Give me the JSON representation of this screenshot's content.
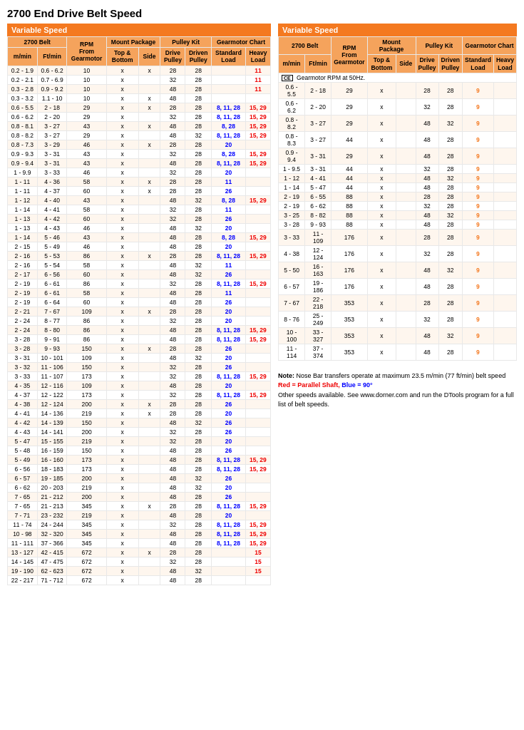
{
  "page": {
    "title": "2700 End Drive Belt Speed"
  },
  "left_table": {
    "section_label": "Variable Speed",
    "col_headers": {
      "belt": "2700 Belt",
      "rpm": "RPM From Gearmotor",
      "mount": "Mount Package",
      "pulley_kit": "Pulley Kit",
      "gearmotor": "Gearmotor Chart"
    },
    "sub_headers": [
      "m/min",
      "Ft/min",
      "",
      "Top & Bottom",
      "Side",
      "Drive Pulley",
      "Driven Pulley",
      "Standard Load",
      "Heavy Load"
    ],
    "rows": [
      [
        "0.2 - 1.9",
        "0.6 - 6.2",
        "10",
        "x",
        "x",
        "28",
        "28",
        "",
        "11"
      ],
      [
        "0.2 - 2.1",
        "0.7 - 6.9",
        "10",
        "x",
        "",
        "32",
        "28",
        "",
        "11"
      ],
      [
        "0.3 - 2.8",
        "0.9 - 9.2",
        "10",
        "x",
        "",
        "48",
        "28",
        "",
        "11"
      ],
      [
        "0.3 - 3.2",
        "1.1 - 10",
        "10",
        "x",
        "x",
        "48",
        "28",
        "",
        ""
      ],
      [
        "0.6 - 5.5",
        "2 - 18",
        "29",
        "x",
        "x",
        "28",
        "28",
        "8, 11, 28",
        "15, 29"
      ],
      [
        "0.6 - 6.2",
        "2 - 20",
        "29",
        "x",
        "",
        "32",
        "28",
        "8, 11, 28",
        "15, 29"
      ],
      [
        "0.8 - 8.1",
        "3 - 27",
        "43",
        "x",
        "x",
        "48",
        "28",
        "8, 28",
        "15, 29"
      ],
      [
        "0.8 - 8.2",
        "3 - 27",
        "29",
        "x",
        "",
        "48",
        "32",
        "8, 11, 28",
        "15, 29"
      ],
      [
        "0.8 - 7.3",
        "3 - 29",
        "46",
        "x",
        "x",
        "28",
        "28",
        "20",
        ""
      ],
      [
        "0.9 - 9.3",
        "3 - 31",
        "43",
        "x",
        "",
        "32",
        "28",
        "8, 28",
        "15, 29"
      ],
      [
        "0.9 - 9.4",
        "3 - 31",
        "43",
        "x",
        "",
        "48",
        "28",
        "8, 11, 28",
        "15, 29"
      ],
      [
        "1 - 9.9",
        "3 - 33",
        "46",
        "x",
        "",
        "32",
        "28",
        "20",
        ""
      ],
      [
        "1 - 11",
        "4 - 36",
        "58",
        "x",
        "x",
        "28",
        "28",
        "11",
        ""
      ],
      [
        "1 - 11",
        "4 - 37",
        "60",
        "x",
        "x",
        "28",
        "28",
        "26",
        ""
      ],
      [
        "1 - 12",
        "4 - 40",
        "43",
        "x",
        "",
        "48",
        "32",
        "8, 28",
        "15, 29"
      ],
      [
        "1 - 14",
        "4 - 41",
        "58",
        "x",
        "",
        "32",
        "28",
        "11",
        ""
      ],
      [
        "1 - 13",
        "4 - 42",
        "60",
        "x",
        "",
        "32",
        "28",
        "26",
        ""
      ],
      [
        "1 - 13",
        "4 - 43",
        "46",
        "x",
        "",
        "48",
        "32",
        "20",
        ""
      ],
      [
        "1 - 14",
        "5 - 46",
        "43",
        "x",
        "",
        "48",
        "28",
        "8, 28",
        "15, 29"
      ],
      [
        "2 - 15",
        "5 - 49",
        "46",
        "x",
        "",
        "48",
        "28",
        "20",
        ""
      ],
      [
        "2 - 16",
        "5 - 53",
        "86",
        "x",
        "x",
        "28",
        "28",
        "8, 11, 28",
        "15, 29"
      ],
      [
        "2 - 16",
        "5 - 54",
        "58",
        "x",
        "",
        "48",
        "32",
        "11",
        ""
      ],
      [
        "2 - 17",
        "6 - 56",
        "60",
        "x",
        "",
        "48",
        "32",
        "26",
        ""
      ],
      [
        "2 - 19",
        "6 - 61",
        "86",
        "x",
        "",
        "32",
        "28",
        "8, 11, 28",
        "15, 29"
      ],
      [
        "2 - 19",
        "6 - 61",
        "58",
        "x",
        "",
        "48",
        "28",
        "11",
        ""
      ],
      [
        "2 - 19",
        "6 - 64",
        "60",
        "x",
        "",
        "48",
        "28",
        "26",
        ""
      ],
      [
        "2 - 21",
        "7 - 67",
        "109",
        "x",
        "x",
        "28",
        "28",
        "20",
        ""
      ],
      [
        "2 - 24",
        "8 - 77",
        "86",
        "x",
        "",
        "32",
        "28",
        "20",
        ""
      ],
      [
        "2 - 24",
        "8 - 80",
        "86",
        "x",
        "",
        "48",
        "28",
        "8, 11, 28",
        "15, 29"
      ],
      [
        "3 - 28",
        "9 - 91",
        "86",
        "x",
        "",
        "48",
        "28",
        "8, 11, 28",
        "15, 29"
      ],
      [
        "3 - 28",
        "9 - 93",
        "150",
        "x",
        "x",
        "28",
        "28",
        "26",
        ""
      ],
      [
        "3 - 31",
        "10 - 101",
        "109",
        "x",
        "",
        "48",
        "32",
        "20",
        ""
      ],
      [
        "3 - 32",
        "11 - 106",
        "150",
        "x",
        "",
        "32",
        "28",
        "26",
        ""
      ],
      [
        "3 - 33",
        "11 - 107",
        "173",
        "x",
        "",
        "32",
        "28",
        "8, 11, 28",
        "15, 29"
      ],
      [
        "4 - 35",
        "12 - 116",
        "109",
        "x",
        "",
        "48",
        "28",
        "20",
        ""
      ],
      [
        "4 - 37",
        "12 - 122",
        "173",
        "x",
        "",
        "32",
        "28",
        "8, 11, 28",
        "15, 29"
      ],
      [
        "4 - 38",
        "12 - 124",
        "200",
        "x",
        "x",
        "28",
        "28",
        "26",
        ""
      ],
      [
        "4 - 41",
        "14 - 136",
        "219",
        "x",
        "x",
        "28",
        "28",
        "20",
        ""
      ],
      [
        "4 - 42",
        "14 - 139",
        "150",
        "x",
        "",
        "48",
        "32",
        "26",
        ""
      ],
      [
        "4 - 43",
        "14 - 141",
        "200",
        "x",
        "",
        "32",
        "28",
        "26",
        ""
      ],
      [
        "5 - 47",
        "15 - 155",
        "219",
        "x",
        "",
        "32",
        "28",
        "20",
        ""
      ],
      [
        "5 - 48",
        "16 - 159",
        "150",
        "x",
        "",
        "48",
        "28",
        "26",
        ""
      ],
      [
        "5 - 49",
        "16 - 160",
        "173",
        "x",
        "",
        "48",
        "28",
        "8, 11, 28",
        "15, 29"
      ],
      [
        "6 - 56",
        "18 - 183",
        "173",
        "x",
        "",
        "48",
        "28",
        "8, 11, 28",
        "15, 29"
      ],
      [
        "6 - 57",
        "19 - 185",
        "200",
        "x",
        "",
        "48",
        "32",
        "26",
        ""
      ],
      [
        "6 - 62",
        "20 - 203",
        "219",
        "x",
        "",
        "48",
        "32",
        "20",
        ""
      ],
      [
        "7 - 65",
        "21 - 212",
        "200",
        "x",
        "",
        "48",
        "28",
        "26",
        ""
      ],
      [
        "7 - 65",
        "21 - 213",
        "345",
        "x",
        "x",
        "28",
        "28",
        "8, 11, 28",
        "15, 29"
      ],
      [
        "7 - 71",
        "23 - 232",
        "219",
        "x",
        "",
        "48",
        "28",
        "20",
        ""
      ],
      [
        "11 - 74",
        "24 - 244",
        "345",
        "x",
        "",
        "32",
        "28",
        "8, 11, 28",
        "15, 29"
      ],
      [
        "10 - 98",
        "32 - 320",
        "345",
        "x",
        "",
        "48",
        "28",
        "8, 11, 28",
        "15, 29"
      ],
      [
        "11 - 111",
        "37 - 366",
        "345",
        "x",
        "",
        "48",
        "28",
        "8, 11, 28",
        "15, 29"
      ],
      [
        "13 - 127",
        "42 - 415",
        "672",
        "x",
        "x",
        "28",
        "28",
        "",
        "15"
      ],
      [
        "14 - 145",
        "47 - 475",
        "672",
        "x",
        "",
        "32",
        "28",
        "",
        "15"
      ],
      [
        "19 - 190",
        "62 - 623",
        "672",
        "x",
        "",
        "48",
        "32",
        "",
        "15"
      ],
      [
        "22 - 217",
        "71 - 712",
        "672",
        "x",
        "",
        "48",
        "28",
        "",
        ""
      ]
    ]
  },
  "right_table": {
    "section_label": "Variable Speed",
    "ce_note": "Gearmotor RPM at 50Hz.",
    "col_headers": {
      "belt": "2700 Belt",
      "rpm": "RPM From Gearmotor",
      "mount": "Mount Package",
      "pulley_kit": "Pulley Kit",
      "gearmotor": "Gearmotor Chart"
    },
    "sub_headers": [
      "m/min",
      "Ft/min",
      "",
      "Top & Bottom",
      "Side",
      "Drive Pulley",
      "Driven Pulley",
      "Standard Load",
      "Heavy Load"
    ],
    "rows": [
      [
        "0.6 - 5.5",
        "2 - 18",
        "29",
        "x",
        "",
        "28",
        "28",
        "9",
        ""
      ],
      [
        "0.6 - 6.2",
        "2 - 20",
        "29",
        "x",
        "",
        "32",
        "28",
        "9",
        ""
      ],
      [
        "0.8 - 8.2",
        "3 - 27",
        "29",
        "x",
        "",
        "48",
        "32",
        "9",
        ""
      ],
      [
        "0.8 - 8.3",
        "3 - 27",
        "44",
        "x",
        "",
        "48",
        "28",
        "9",
        ""
      ],
      [
        "0.9 - 9.4",
        "3 - 31",
        "29",
        "x",
        "",
        "48",
        "28",
        "9",
        ""
      ],
      [
        "1 - 9.5",
        "3 - 31",
        "44",
        "x",
        "",
        "32",
        "28",
        "9",
        ""
      ],
      [
        "1 - 12",
        "4 - 41",
        "44",
        "x",
        "",
        "48",
        "32",
        "9",
        ""
      ],
      [
        "1 - 14",
        "5 - 47",
        "44",
        "x",
        "",
        "48",
        "28",
        "9",
        ""
      ],
      [
        "2 - 19",
        "6 - 55",
        "88",
        "x",
        "",
        "28",
        "28",
        "9",
        ""
      ],
      [
        "2 - 19",
        "6 - 62",
        "88",
        "x",
        "",
        "32",
        "28",
        "9",
        ""
      ],
      [
        "3 - 25",
        "8 - 82",
        "88",
        "x",
        "",
        "48",
        "32",
        "9",
        ""
      ],
      [
        "3 - 28",
        "9 - 93",
        "88",
        "x",
        "",
        "48",
        "28",
        "9",
        ""
      ],
      [
        "3 - 33",
        "11 - 109",
        "176",
        "x",
        "",
        "28",
        "28",
        "9",
        ""
      ],
      [
        "4 - 38",
        "12 - 124",
        "176",
        "x",
        "",
        "32",
        "28",
        "9",
        ""
      ],
      [
        "5 - 50",
        "16 - 163",
        "176",
        "x",
        "",
        "48",
        "32",
        "9",
        ""
      ],
      [
        "6 - 57",
        "19 - 186",
        "176",
        "x",
        "",
        "48",
        "28",
        "9",
        ""
      ],
      [
        "7 - 67",
        "22 - 218",
        "353",
        "x",
        "",
        "28",
        "28",
        "9",
        ""
      ],
      [
        "8 - 76",
        "25 - 249",
        "353",
        "x",
        "",
        "32",
        "28",
        "9",
        ""
      ],
      [
        "10 - 100",
        "33 - 327",
        "353",
        "x",
        "",
        "48",
        "32",
        "9",
        ""
      ],
      [
        "11 - 114",
        "37 - 374",
        "353",
        "x",
        "",
        "48",
        "28",
        "9",
        ""
      ]
    ]
  },
  "notes": {
    "note_label": "Note:",
    "note_text": "Nose Bar transfers operate at maximum 23.5 m/min (77 ft/min) belt speed",
    "legend_red": "Red = Parallel Shaft,",
    "legend_blue": "Blue = 90°",
    "other_speeds": "Other speeds available. See www.dorner.com and run the DTools program for a full list of belt speeds."
  }
}
